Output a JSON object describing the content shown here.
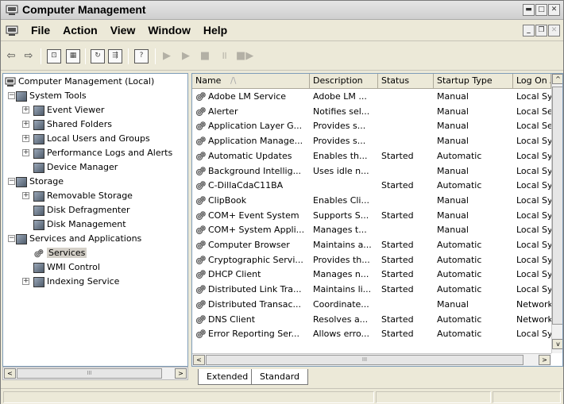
{
  "window": {
    "title": "Computer Management",
    "title_buttons": [
      "minimize",
      "maximize",
      "close"
    ]
  },
  "menubar": {
    "items": [
      "File",
      "Action",
      "View",
      "Window",
      "Help"
    ]
  },
  "toolbar": {
    "icons": [
      "back-icon",
      "forward-icon",
      "up-folder-icon",
      "show-hide-tree-icon",
      "refresh-icon",
      "export-list-icon",
      "help-icon",
      "start-service-icon",
      "play-icon",
      "stop-icon",
      "pause-icon",
      "restart-icon"
    ]
  },
  "tree": {
    "root": "Computer Management (Local)",
    "items": [
      {
        "label": "System Tools",
        "level": 1,
        "expander": "−",
        "icon": "tools-icon"
      },
      {
        "label": "Event Viewer",
        "level": 2,
        "expander": "+",
        "icon": "event-viewer-icon"
      },
      {
        "label": "Shared Folders",
        "level": 2,
        "expander": "+",
        "icon": "shared-folders-icon"
      },
      {
        "label": "Local Users and Groups",
        "level": 2,
        "expander": "+",
        "icon": "users-icon"
      },
      {
        "label": "Performance Logs and Alerts",
        "level": 2,
        "expander": "+",
        "icon": "performance-icon"
      },
      {
        "label": "Device Manager",
        "level": 2,
        "expander": "",
        "icon": "device-manager-icon"
      },
      {
        "label": "Storage",
        "level": 1,
        "expander": "−",
        "icon": "storage-icon"
      },
      {
        "label": "Removable Storage",
        "level": 2,
        "expander": "+",
        "icon": "removable-storage-icon"
      },
      {
        "label": "Disk Defragmenter",
        "level": 2,
        "expander": "",
        "icon": "defrag-icon"
      },
      {
        "label": "Disk Management",
        "level": 2,
        "expander": "",
        "icon": "disk-management-icon"
      },
      {
        "label": "Services and Applications",
        "level": 1,
        "expander": "−",
        "icon": "services-apps-icon"
      },
      {
        "label": "Services",
        "level": 2,
        "expander": "",
        "icon": "gear-icon",
        "selected": true
      },
      {
        "label": "WMI Control",
        "level": 2,
        "expander": "",
        "icon": "wmi-icon"
      },
      {
        "label": "Indexing Service",
        "level": 2,
        "expander": "+",
        "icon": "indexing-icon"
      }
    ]
  },
  "list": {
    "columns": [
      "Name",
      "Description",
      "Status",
      "Startup Type",
      "Log On A"
    ],
    "sort_indicator": "/\\",
    "rows": [
      [
        "Adobe LM Service",
        "Adobe LM ...",
        "",
        "Manual",
        "Local Sys"
      ],
      [
        "Alerter",
        "Notifies sel...",
        "",
        "Manual",
        "Local Ser"
      ],
      [
        "Application Layer G...",
        "Provides s...",
        "",
        "Manual",
        "Local Ser"
      ],
      [
        "Application Manage...",
        "Provides s...",
        "",
        "Manual",
        "Local Sys"
      ],
      [
        "Automatic Updates",
        "Enables th...",
        "Started",
        "Automatic",
        "Local Sys"
      ],
      [
        "Background Intellig...",
        "Uses idle n...",
        "",
        "Manual",
        "Local Sys"
      ],
      [
        "C-DillaCdaC11BA",
        "",
        "Started",
        "Automatic",
        "Local Sys"
      ],
      [
        "ClipBook",
        "Enables Cli...",
        "",
        "Manual",
        "Local Sys"
      ],
      [
        "COM+ Event System",
        "Supports S...",
        "Started",
        "Manual",
        "Local Sys"
      ],
      [
        "COM+ System Appli...",
        "Manages t...",
        "",
        "Manual",
        "Local Sys"
      ],
      [
        "Computer Browser",
        "Maintains a...",
        "Started",
        "Automatic",
        "Local Sys"
      ],
      [
        "Cryptographic Servi...",
        "Provides th...",
        "Started",
        "Automatic",
        "Local Sys"
      ],
      [
        "DHCP Client",
        "Manages n...",
        "Started",
        "Automatic",
        "Local Sys"
      ],
      [
        "Distributed Link Tra...",
        "Maintains li...",
        "Started",
        "Automatic",
        "Local Sys"
      ],
      [
        "Distributed Transac...",
        "Coordinate...",
        "",
        "Manual",
        "Network"
      ],
      [
        "DNS Client",
        "Resolves a...",
        "Started",
        "Automatic",
        "Network"
      ],
      [
        "Error Reporting Ser...",
        "Allows erro...",
        "Started",
        "Automatic",
        "Local Sys"
      ]
    ]
  },
  "tabs": [
    "Extended",
    "Standard"
  ],
  "scroll_marks": {
    "left": "<",
    "right": ">",
    "up": "^",
    "down": "v",
    "grip": "III"
  }
}
